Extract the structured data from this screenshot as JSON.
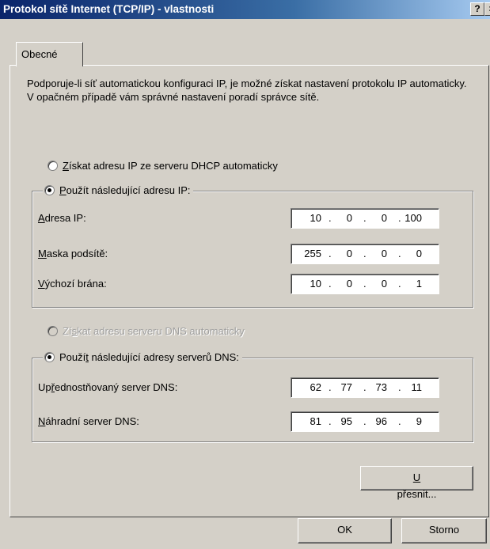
{
  "window": {
    "title": "Protokol sítě Internet (TCP/IP) - vlastnosti",
    "help_glyph": "?",
    "close_glyph": "×"
  },
  "tabs": [
    {
      "label": "Obecné"
    }
  ],
  "description": "Podporuje-li síť automatickou konfiguraci IP, je možné získat nastavení protokolu IP automaticky. V opačném případě vám správné nastavení poradí správce sítě.",
  "ip": {
    "auto_option": {
      "ul": "Z",
      "rest": "ískat adresu IP ze serveru DHCP automaticky",
      "selected": false
    },
    "manual_option": {
      "ul": "P",
      "rest": "oužít následující adresu IP:",
      "selected": true
    },
    "fields": [
      {
        "ul": "A",
        "rest": "dresa IP:",
        "octets": [
          "10",
          "0",
          "0",
          "100"
        ]
      },
      {
        "ul": "M",
        "rest": "aska podsítě:",
        "octets": [
          "255",
          "0",
          "0",
          "0"
        ]
      },
      {
        "ul": "V",
        "rest": "ýchozí brána:",
        "octets": [
          "10",
          "0",
          "0",
          "1"
        ]
      }
    ]
  },
  "dns": {
    "auto_option": {
      "pre": "Zí",
      "ul": "s",
      "rest": "kat adresu serveru DNS automaticky",
      "selected": false,
      "disabled": true
    },
    "manual_option": {
      "pre": "Použí",
      "ul": "t",
      "rest": " následující adresy serverů DNS:",
      "selected": true
    },
    "fields": [
      {
        "pre": "Up",
        "ul": "ř",
        "rest": "ednostňovaný server DNS:",
        "octets": [
          "62",
          "77",
          "73",
          "11"
        ]
      },
      {
        "pre": "",
        "ul": "N",
        "rest": "áhradní server DNS:",
        "octets": [
          "81",
          "95",
          "96",
          "9"
        ]
      }
    ]
  },
  "buttons": {
    "advanced": {
      "ul": "U",
      "rest": "přesnit..."
    },
    "ok": "OK",
    "cancel": "Storno"
  }
}
